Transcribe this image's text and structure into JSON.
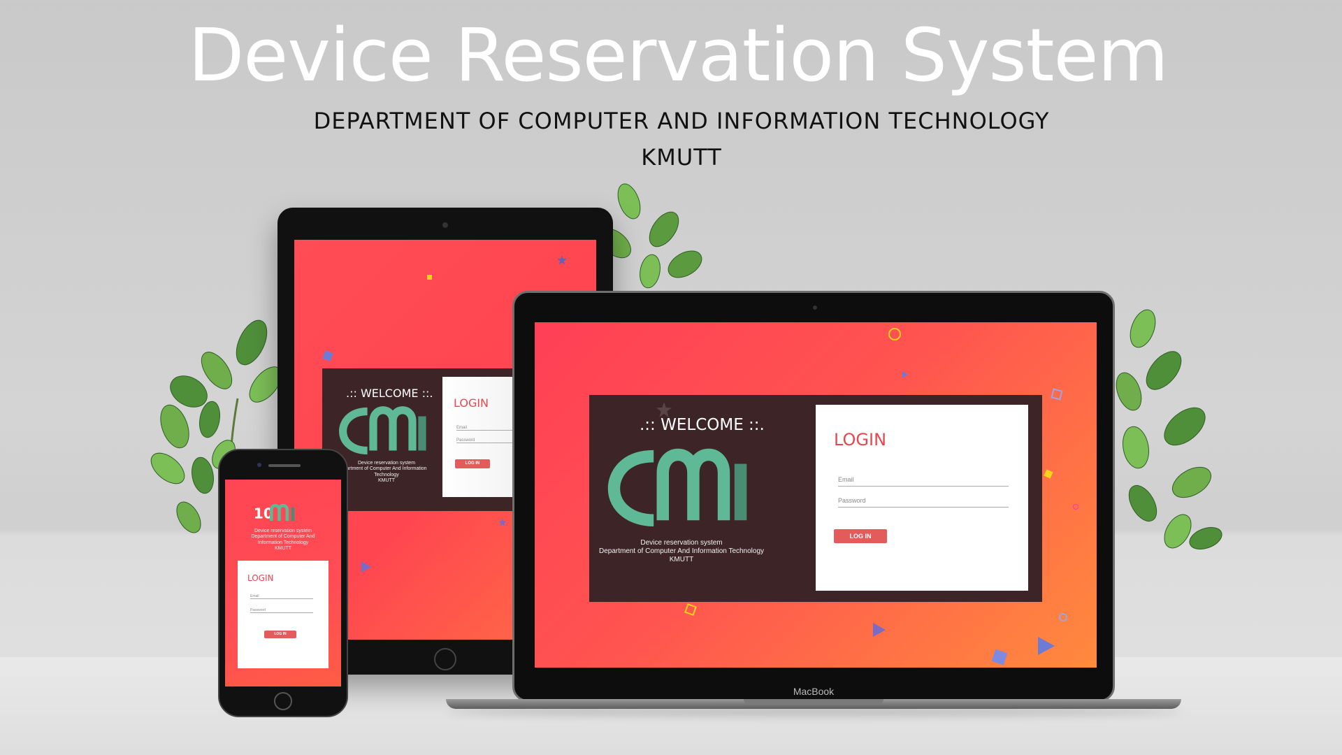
{
  "hero": {
    "title": "Device Reservation System",
    "subtitle_line1": "DEPARTMENT OF COMPUTER AND INFORMATION TECHNOLOGY",
    "subtitle_line2": "KMUTT"
  },
  "colors": {
    "gradient_red": "#ff4553",
    "gradient_orange": "#ff8a3d",
    "panel_brown": "#3d2527",
    "logo_green": "#5fb896",
    "login_red": "#e8474f",
    "button_red": "#e45b5b"
  },
  "laptop": {
    "brand": "MacBook",
    "welcome": ".:: WELCOME ::.",
    "tagline": [
      "Device reservation system",
      "Department of Computer And Information Technology",
      "KMUTT"
    ],
    "login_title": "LOGIN",
    "email_placeholder": "Email",
    "password_placeholder": "Password",
    "login_button": "LOG IN"
  },
  "tablet": {
    "welcome": ".:: WELCOME ::.",
    "tagline": [
      "Device reservation system",
      "artment of Computer And Information",
      "Technology",
      "KMUTT"
    ],
    "login_title": "LOGIN",
    "email_placeholder": "Email",
    "password_placeholder": "Password",
    "login_button": "LOG IN"
  },
  "phone": {
    "tagline": [
      "Device reservation system",
      "Department of Computer And",
      "Information Technology",
      "KMUTT"
    ],
    "login_title": "LOGIN",
    "email_placeholder": "Email",
    "password_placeholder": "Password",
    "login_button": "LOG IN"
  },
  "icons": [
    "leaf-plant-icon",
    "star-confetti-icon",
    "circle-confetti-icon",
    "triangle-confetti-icon",
    "cube-confetti-icon"
  ]
}
